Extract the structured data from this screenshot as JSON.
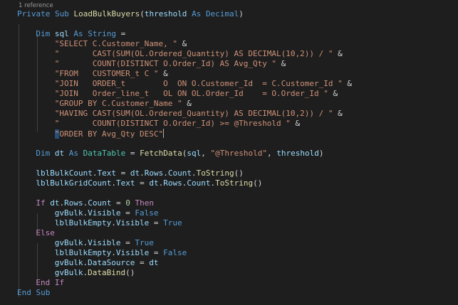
{
  "editor": {
    "codelens": "1 reference",
    "lines": [
      {
        "indent": 4,
        "tokens": [
          {
            "t": "Private Sub ",
            "c": "kw"
          },
          {
            "t": "LoadBulkBuyers",
            "c": "fn"
          },
          {
            "t": "(",
            "c": "pln"
          },
          {
            "t": "threshold",
            "c": "var"
          },
          {
            "t": " ",
            "c": "pln"
          },
          {
            "t": "As",
            "c": "kw"
          },
          {
            "t": " ",
            "c": "pln"
          },
          {
            "t": "Decimal",
            "c": "kw"
          },
          {
            "t": ")",
            "c": "pln"
          }
        ]
      },
      {
        "indent": 0,
        "tokens": []
      },
      {
        "indent": 8,
        "tokens": [
          {
            "t": "Dim ",
            "c": "kw"
          },
          {
            "t": "sql",
            "c": "var"
          },
          {
            "t": " ",
            "c": "pln"
          },
          {
            "t": "As",
            "c": "kw"
          },
          {
            "t": " ",
            "c": "pln"
          },
          {
            "t": "String",
            "c": "kw"
          },
          {
            "t": " =",
            "c": "pln"
          }
        ]
      },
      {
        "indent": 12,
        "tokens": [
          {
            "t": "\"SELECT C.Customer_Name, \"",
            "c": "str"
          },
          {
            "t": " &",
            "c": "pln"
          }
        ]
      },
      {
        "indent": 12,
        "tokens": [
          {
            "t": "\"       CAST(SUM(OL.Ordered_Quantity) AS DECIMAL(10,2)) / \"",
            "c": "str"
          },
          {
            "t": " &",
            "c": "pln"
          }
        ]
      },
      {
        "indent": 12,
        "tokens": [
          {
            "t": "\"       COUNT(DISTINCT O.Order_Id) AS Avg_Qty \"",
            "c": "str"
          },
          {
            "t": " &",
            "c": "pln"
          }
        ]
      },
      {
        "indent": 12,
        "tokens": [
          {
            "t": "\"FROM   CUSTOMER_t C \"",
            "c": "str"
          },
          {
            "t": " &",
            "c": "pln"
          }
        ]
      },
      {
        "indent": 12,
        "tokens": [
          {
            "t": "\"JOIN   ORDER_t        O  ON O.Customer_Id  = C.Customer_Id \"",
            "c": "str"
          },
          {
            "t": " &",
            "c": "pln"
          }
        ]
      },
      {
        "indent": 12,
        "tokens": [
          {
            "t": "\"JOIN   Order_line_t   OL ON OL.Order_Id    = O.Order_Id \"",
            "c": "str"
          },
          {
            "t": " &",
            "c": "pln"
          }
        ]
      },
      {
        "indent": 12,
        "tokens": [
          {
            "t": "\"GROUP BY C.Customer_Name \"",
            "c": "str"
          },
          {
            "t": " &",
            "c": "pln"
          }
        ]
      },
      {
        "indent": 12,
        "tokens": [
          {
            "t": "\"HAVING CAST(SUM(OL.Ordered_Quantity) AS DECIMAL(10,2)) / \"",
            "c": "str"
          },
          {
            "t": " &",
            "c": "pln"
          }
        ]
      },
      {
        "indent": 12,
        "tokens": [
          {
            "t": "\"       COUNT(DISTINCT O.Order_Id) >= @Threshold \"",
            "c": "str"
          },
          {
            "t": " &",
            "c": "pln"
          }
        ]
      },
      {
        "indent": 12,
        "tokens": [
          {
            "t": "\"",
            "c": "str hl"
          },
          {
            "t": "ORDER BY Avg_Qty DESC\"",
            "c": "str"
          },
          {
            "cursor": true
          }
        ]
      },
      {
        "indent": 0,
        "tokens": []
      },
      {
        "indent": 8,
        "tokens": [
          {
            "t": "Dim ",
            "c": "kw"
          },
          {
            "t": "dt",
            "c": "var"
          },
          {
            "t": " ",
            "c": "pln"
          },
          {
            "t": "As",
            "c": "kw"
          },
          {
            "t": " ",
            "c": "pln"
          },
          {
            "t": "DataTable",
            "c": "typ"
          },
          {
            "t": " = ",
            "c": "pln"
          },
          {
            "t": "FetchData",
            "c": "fn"
          },
          {
            "t": "(",
            "c": "pln"
          },
          {
            "t": "sql",
            "c": "var"
          },
          {
            "t": ", ",
            "c": "pln"
          },
          {
            "t": "\"@Threshold\"",
            "c": "str"
          },
          {
            "t": ", ",
            "c": "pln"
          },
          {
            "t": "threshold",
            "c": "var"
          },
          {
            "t": ")",
            "c": "pln"
          }
        ]
      },
      {
        "indent": 0,
        "tokens": []
      },
      {
        "indent": 8,
        "tokens": [
          {
            "t": "lblBulkCount",
            "c": "var"
          },
          {
            "t": ".",
            "c": "pln"
          },
          {
            "t": "Text",
            "c": "var"
          },
          {
            "t": " = ",
            "c": "pln"
          },
          {
            "t": "dt",
            "c": "var"
          },
          {
            "t": ".",
            "c": "pln"
          },
          {
            "t": "Rows",
            "c": "var"
          },
          {
            "t": ".",
            "c": "pln"
          },
          {
            "t": "Count",
            "c": "var"
          },
          {
            "t": ".",
            "c": "pln"
          },
          {
            "t": "ToString",
            "c": "fn"
          },
          {
            "t": "()",
            "c": "pln"
          }
        ]
      },
      {
        "indent": 8,
        "tokens": [
          {
            "t": "lblBulkGridCount",
            "c": "var"
          },
          {
            "t": ".",
            "c": "pln"
          },
          {
            "t": "Text",
            "c": "var"
          },
          {
            "t": " = ",
            "c": "pln"
          },
          {
            "t": "dt",
            "c": "var"
          },
          {
            "t": ".",
            "c": "pln"
          },
          {
            "t": "Rows",
            "c": "var"
          },
          {
            "t": ".",
            "c": "pln"
          },
          {
            "t": "Count",
            "c": "var"
          },
          {
            "t": ".",
            "c": "pln"
          },
          {
            "t": "ToString",
            "c": "fn"
          },
          {
            "t": "()",
            "c": "pln"
          }
        ]
      },
      {
        "indent": 0,
        "tokens": []
      },
      {
        "indent": 8,
        "tokens": [
          {
            "t": "If",
            "c": "ctl"
          },
          {
            "t": " ",
            "c": "pln"
          },
          {
            "t": "dt",
            "c": "var"
          },
          {
            "t": ".",
            "c": "pln"
          },
          {
            "t": "Rows",
            "c": "var"
          },
          {
            "t": ".",
            "c": "pln"
          },
          {
            "t": "Count",
            "c": "var"
          },
          {
            "t": " = ",
            "c": "pln"
          },
          {
            "t": "0",
            "c": "num"
          },
          {
            "t": " ",
            "c": "pln"
          },
          {
            "t": "Then",
            "c": "ctl"
          }
        ]
      },
      {
        "indent": 12,
        "tokens": [
          {
            "t": "gvBulk",
            "c": "var"
          },
          {
            "t": ".",
            "c": "pln"
          },
          {
            "t": "Visible",
            "c": "var"
          },
          {
            "t": " = ",
            "c": "pln"
          },
          {
            "t": "False",
            "c": "kw"
          }
        ]
      },
      {
        "indent": 12,
        "tokens": [
          {
            "t": "lblBulkEmpty",
            "c": "var"
          },
          {
            "t": ".",
            "c": "pln"
          },
          {
            "t": "Visible",
            "c": "var"
          },
          {
            "t": " = ",
            "c": "pln"
          },
          {
            "t": "True",
            "c": "kw"
          }
        ]
      },
      {
        "indent": 8,
        "tokens": [
          {
            "t": "Else",
            "c": "ctl"
          }
        ]
      },
      {
        "indent": 12,
        "tokens": [
          {
            "t": "gvBulk",
            "c": "var"
          },
          {
            "t": ".",
            "c": "pln"
          },
          {
            "t": "Visible",
            "c": "var"
          },
          {
            "t": " = ",
            "c": "pln"
          },
          {
            "t": "True",
            "c": "kw"
          }
        ]
      },
      {
        "indent": 12,
        "tokens": [
          {
            "t": "lblBulkEmpty",
            "c": "var"
          },
          {
            "t": ".",
            "c": "pln"
          },
          {
            "t": "Visible",
            "c": "var"
          },
          {
            "t": " = ",
            "c": "pln"
          },
          {
            "t": "False",
            "c": "kw"
          }
        ]
      },
      {
        "indent": 12,
        "tokens": [
          {
            "t": "gvBulk",
            "c": "var"
          },
          {
            "t": ".",
            "c": "pln"
          },
          {
            "t": "DataSource",
            "c": "var"
          },
          {
            "t": " = ",
            "c": "pln"
          },
          {
            "t": "dt",
            "c": "var"
          }
        ]
      },
      {
        "indent": 12,
        "tokens": [
          {
            "t": "gvBulk",
            "c": "var"
          },
          {
            "t": ".",
            "c": "pln"
          },
          {
            "t": "DataBind",
            "c": "fn"
          },
          {
            "t": "()",
            "c": "pln"
          }
        ]
      },
      {
        "indent": 8,
        "tokens": [
          {
            "t": "End If",
            "c": "ctl"
          }
        ]
      },
      {
        "indent": 4,
        "tokens": [
          {
            "t": "End Sub",
            "c": "kw"
          }
        ]
      }
    ]
  },
  "theme": {
    "background": "#1e1e1e",
    "keyword": "#569cd6",
    "control": "#c586c0",
    "string": "#ce9178",
    "variable": "#9cdcfe",
    "function": "#dcdcaa",
    "type": "#4ec9b0",
    "number": "#b5cea8",
    "selection": "#264f78"
  }
}
